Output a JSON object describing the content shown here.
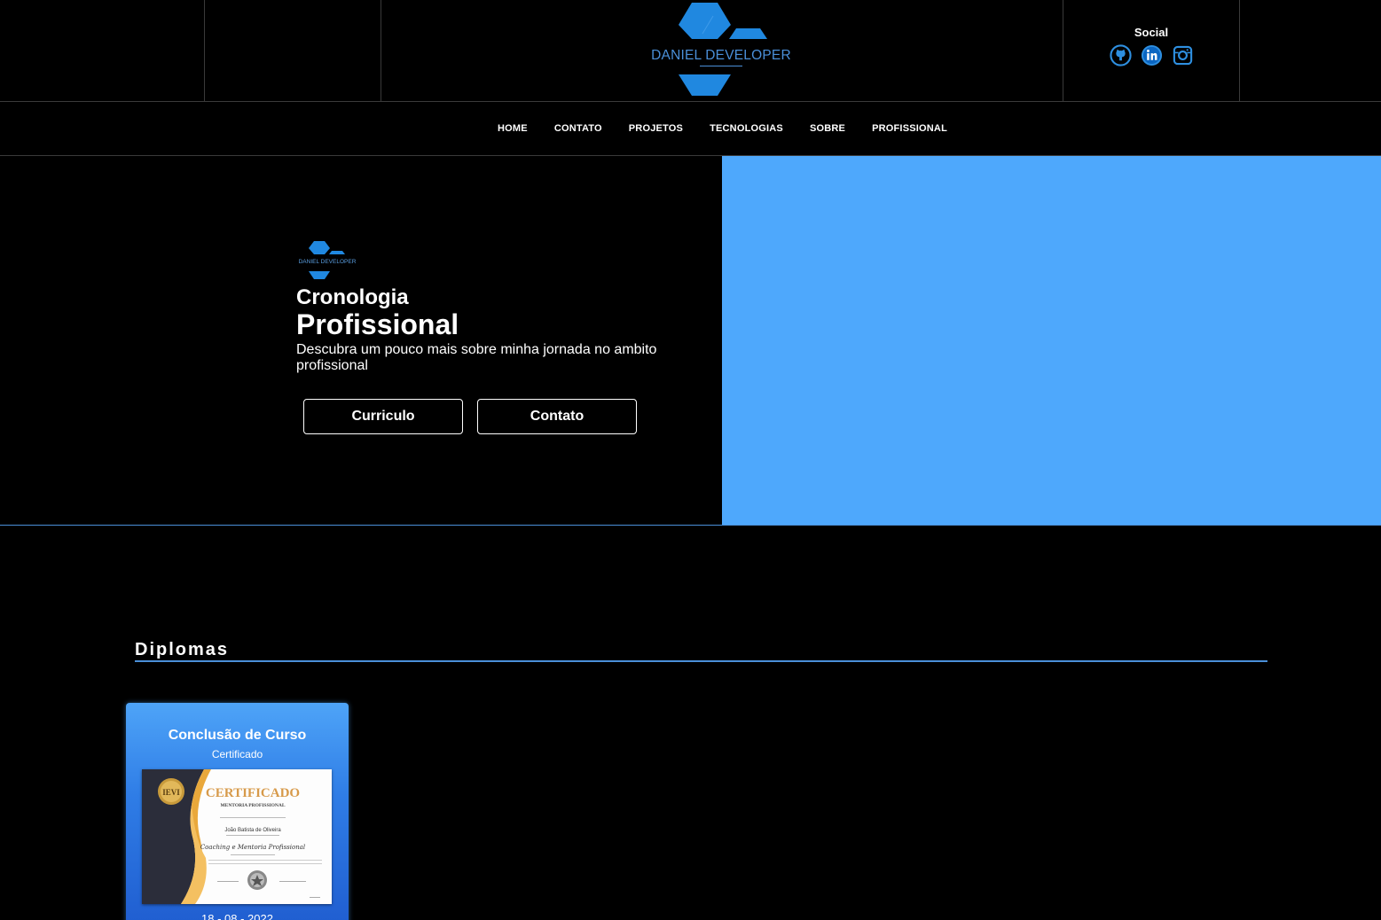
{
  "header": {
    "logo_text": "DANIEL DEVELOPER",
    "social": {
      "title": "Social",
      "icons": [
        "github-icon",
        "linkedin-icon",
        "instagram-icon"
      ]
    }
  },
  "nav": {
    "items": [
      "HOME",
      "CONTATO",
      "PROJETOS",
      "TECNOLOGIAS",
      "SOBRE",
      "PROFISSIONAL"
    ]
  },
  "hero": {
    "mini_logo_text": "DANIEL DEVELOPER",
    "subtitle": "Cronologia",
    "title": "Profissional",
    "description": "Descubra um pouco mais sobre minha jornada no ambito profissional",
    "buttons": [
      "Curriculo",
      "Contato"
    ]
  },
  "diplomas": {
    "section_title": "Diplomas",
    "cards": [
      {
        "title": "Conclusão de Curso",
        "subtitle": "Certificado",
        "image": {
          "heading": "CERTIFICADO",
          "subheading": "MENTORIA PROFISSIONAL",
          "name": "João Batista de Oliveira",
          "course": "Coaching e Mentoria Profissional",
          "seal": "IEVI"
        },
        "date": "18 - 08 - 2022"
      }
    ]
  },
  "colors": {
    "background": "#000000",
    "accent": "#4ea8fc",
    "line": "#4a8fd8"
  }
}
